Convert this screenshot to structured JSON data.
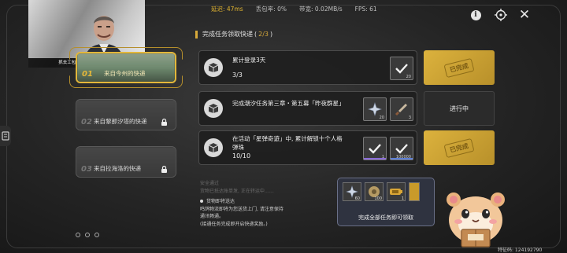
{
  "hud": {
    "latency": "延迟: 47ms",
    "packet_loss": "丢包率: 0%",
    "bandwidth": "带宽: 0.02MB/s",
    "fps": "FPS: 61"
  },
  "webcam": {
    "caption": "抓去工包手就能騙了摔了情况"
  },
  "section": {
    "title": "完成任务领取快递",
    "progress_open": "(",
    "progress": "2/3",
    "progress_close": ")"
  },
  "couriers": [
    {
      "index": "01",
      "name": "来自今州的快递",
      "locked": false,
      "selected": true
    },
    {
      "index": "02",
      "name": "来自黎那汐塔的快递",
      "locked": true,
      "selected": false
    },
    {
      "index": "03",
      "name": "来自拉海洛的快递",
      "locked": true,
      "selected": false
    }
  ],
  "quests": [
    {
      "title": "累计登录3天",
      "progress": "3/3",
      "status": "已完成",
      "rewards": [
        {
          "icon": "checkmark-icon",
          "count": "20"
        }
      ]
    },
    {
      "title": "完成潮汐任务第三章・第五幕「昨夜群星」",
      "progress": "",
      "status": "进行中",
      "rewards": [
        {
          "icon": "shard-icon",
          "count": "20"
        },
        {
          "icon": "sword-icon",
          "count": "3"
        }
      ]
    },
    {
      "title_line1": "在活动「星弹奇遊」中, 累计解锁十个人格",
      "title_line2": "弹珠",
      "progress": "10/10",
      "status": "已完成",
      "rewards": [
        {
          "icon": "checkmark-icon",
          "count": "1"
        },
        {
          "icon": "checkmark-icon",
          "count": "100000"
        }
      ]
    }
  ],
  "info": {
    "line1": "安全通过",
    "line2": "货物已抵达账单发, 正在转运中……",
    "line3": "货物即将送达",
    "line4": "鸣鸽物流即将为您送货上门, 请注意保持",
    "line5": "通讯畅通。",
    "line6": "(接通任务完成即开启快递奖励。)"
  },
  "reward_panel": {
    "label": "完成全部任务即可领取",
    "items": [
      {
        "icon": "shard-icon",
        "count": "60"
      },
      {
        "icon": "gear-disc-icon",
        "count": "100"
      },
      {
        "icon": "battery-icon",
        "count": "1"
      },
      {
        "icon": "gold-partial-icon",
        "count": ""
      }
    ]
  },
  "uid": "特征码: 124192790",
  "colors": {
    "accent_gold": "#e3b73a",
    "done_gold": "#dcb23d",
    "latency": "#e2b531"
  }
}
